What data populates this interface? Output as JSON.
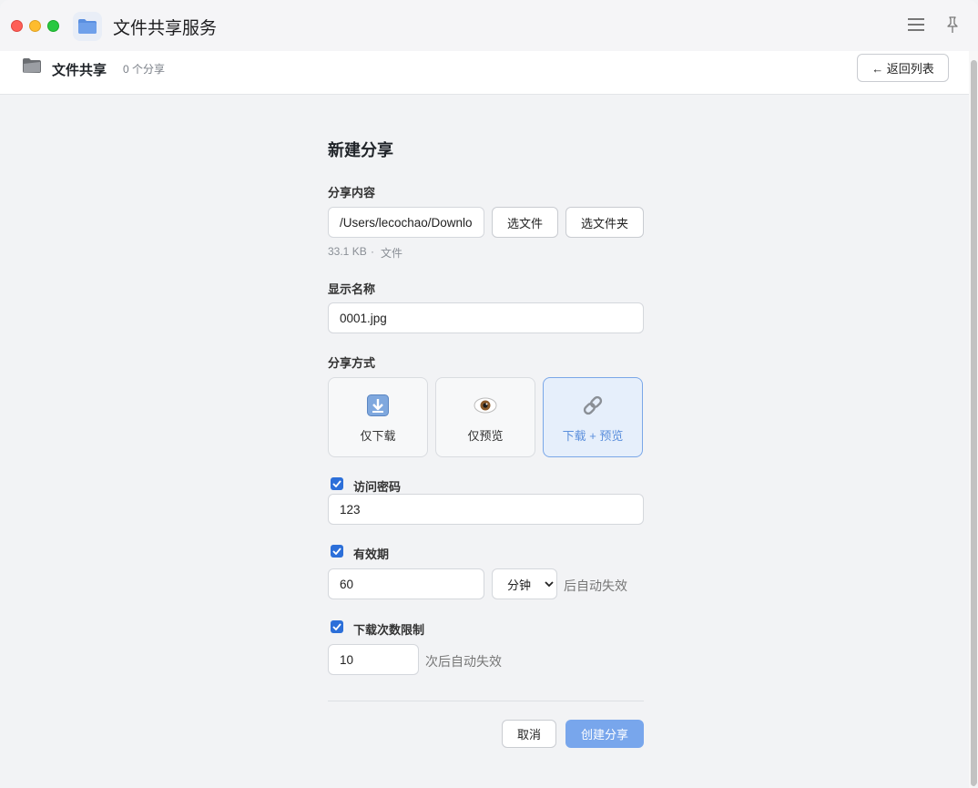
{
  "window": {
    "title": "文件共享服务"
  },
  "header": {
    "title": "文件共享",
    "count": "0 个分享",
    "back_label": "← 返回列表"
  },
  "form": {
    "heading": "新建分享",
    "content": {
      "label": "分享内容",
      "path": "/Users/lecochao/Downlo",
      "pick_file": "选文件",
      "pick_folder": "选文件夹",
      "size": "33.1 KB",
      "sep": "·",
      "kind": "文件"
    },
    "display_name": {
      "label": "显示名称",
      "value": "0001.jpg"
    },
    "mode": {
      "label": "分享方式",
      "options": [
        {
          "label": "仅下载",
          "icon": "download-arrow-icon",
          "selected": false
        },
        {
          "label": "仅预览",
          "icon": "eye-icon",
          "selected": false
        },
        {
          "label": "下载 + 预览",
          "icon": "link-icon",
          "selected": true
        }
      ]
    },
    "password": {
      "label": "访问密码",
      "checked": true,
      "value": "123"
    },
    "expiry": {
      "label": "有效期",
      "checked": true,
      "value": "60",
      "unit": "分钟",
      "suffix": "后自动失效"
    },
    "download_limit": {
      "label": "下载次数限制",
      "checked": true,
      "value": "10",
      "suffix": "次后自动失效"
    },
    "cancel_label": "取消",
    "submit_label": "创建分享"
  },
  "colors": {
    "accent": "#2c6fd9",
    "primary_button": "#78a6ec",
    "selected_card": "#e6effb"
  }
}
